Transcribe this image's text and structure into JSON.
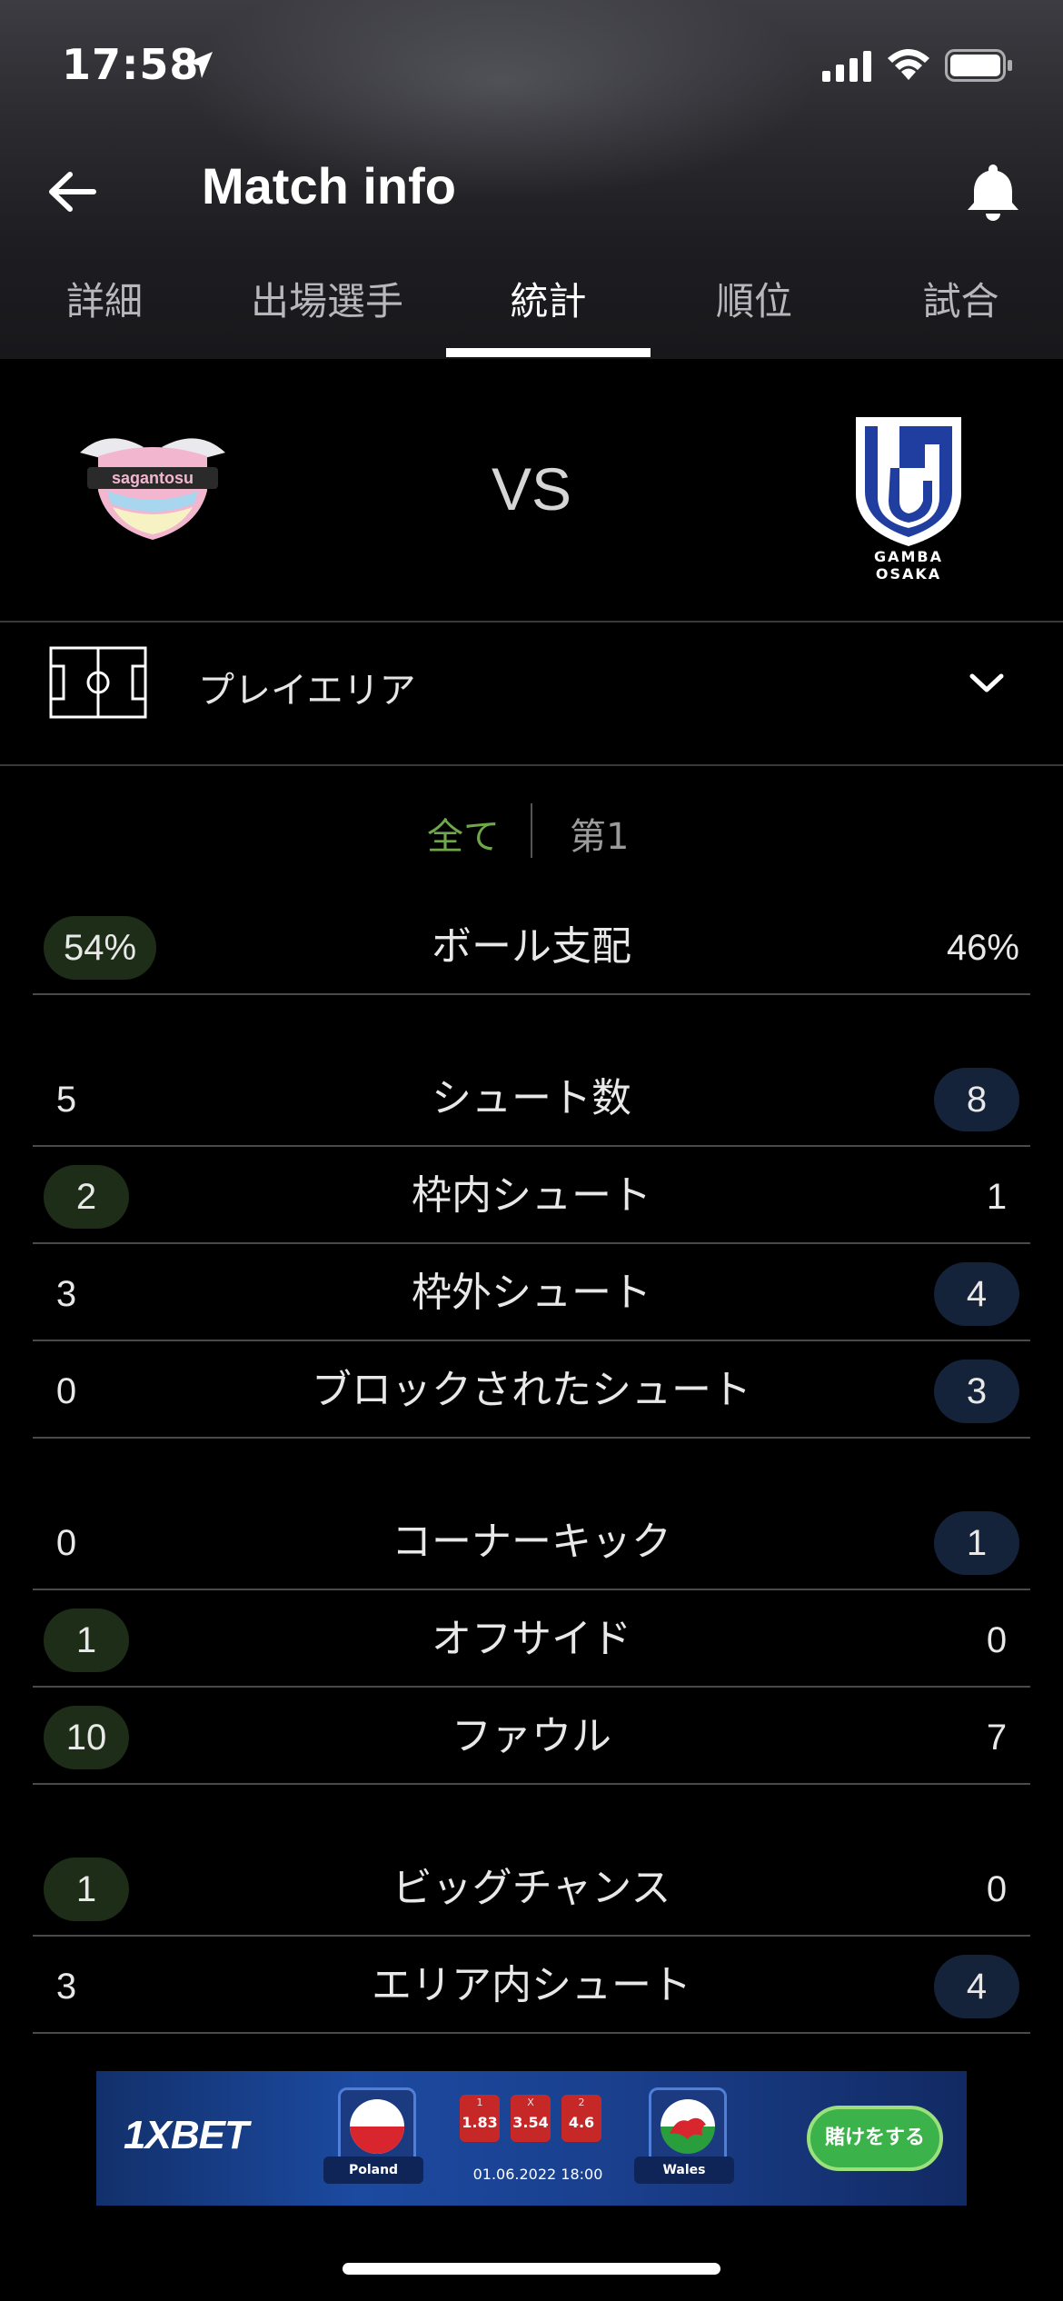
{
  "status_bar": {
    "time": "17:58"
  },
  "nav": {
    "title": "Match info"
  },
  "tabs": [
    {
      "label": "詳細"
    },
    {
      "label": "出場選手"
    },
    {
      "label": "統計"
    },
    {
      "label": "順位"
    },
    {
      "label": "試合"
    }
  ],
  "active_tab": "統計",
  "match": {
    "home_logo_text": "sagantosu",
    "vs": "VS",
    "away_caption": "GAMBA OSAKA"
  },
  "play_area": {
    "label": "プレイエリア"
  },
  "period": {
    "all": "全て",
    "first": "第1"
  },
  "colors": {
    "home_highlight": "#1e2d17",
    "away_highlight": "#14233a",
    "period_active": "#6fa84a",
    "ad_cta": "#3bb34a"
  },
  "stats": [
    {
      "name": "ボール支配",
      "home": "54%",
      "away": "46%",
      "leader": "home"
    },
    {
      "name": "シュート数",
      "home": "5",
      "away": "8",
      "leader": "away"
    },
    {
      "name": "枠内シュート",
      "home": "2",
      "away": "1",
      "leader": "home"
    },
    {
      "name": "枠外シュート",
      "home": "3",
      "away": "4",
      "leader": "away"
    },
    {
      "name": "ブロックされたシュート",
      "home": "0",
      "away": "3",
      "leader": "away"
    },
    {
      "name": "コーナーキック",
      "home": "0",
      "away": "1",
      "leader": "away"
    },
    {
      "name": "オフサイド",
      "home": "1",
      "away": "0",
      "leader": "home"
    },
    {
      "name": "ファウル",
      "home": "10",
      "away": "7",
      "leader": "home"
    },
    {
      "name": "ビッグチャンス",
      "home": "1",
      "away": "0",
      "leader": "home"
    },
    {
      "name": "エリア内シュート",
      "home": "3",
      "away": "4",
      "leader": "away"
    }
  ],
  "ad": {
    "brand": "1XBET",
    "team1": "Poland",
    "team2": "Wales",
    "odds": [
      {
        "key": "1",
        "value": "1.83"
      },
      {
        "key": "X",
        "value": "3.54"
      },
      {
        "key": "2",
        "value": "4.6"
      }
    ],
    "datetime": "01.06.2022 18:00",
    "cta": "賭けをする"
  }
}
